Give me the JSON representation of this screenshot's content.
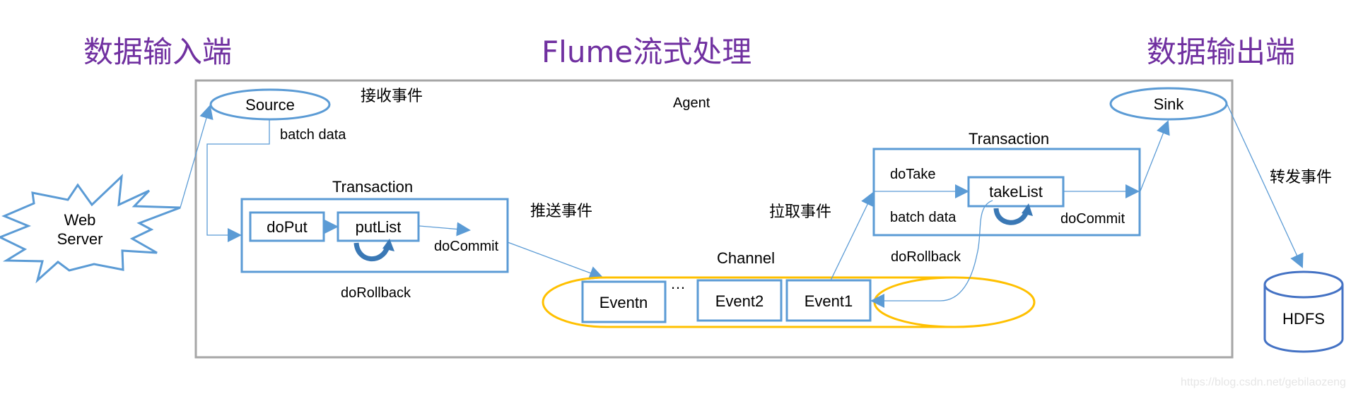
{
  "titles": {
    "input_end": "数据输入端",
    "main": "Flume流式处理",
    "output_end": "数据输出端"
  },
  "agent": {
    "label": "Agent"
  },
  "web_server": {
    "line1": "Web",
    "line2": "Server"
  },
  "source": {
    "label": "Source",
    "receive_label": "接收事件",
    "batch_label": "batch data"
  },
  "put_transaction": {
    "title": "Transaction",
    "do_put": "doPut",
    "put_list": "putList",
    "do_commit": "doCommit",
    "do_rollback": "doRollback",
    "push_label": "推送事件"
  },
  "channel": {
    "label": "Channel",
    "events": [
      "Eventn",
      "Event2",
      "Event1"
    ],
    "ellipsis": "…"
  },
  "take_transaction": {
    "title": "Transaction",
    "do_take": "doTake",
    "take_list": "takeList",
    "batch_label": "batch data",
    "do_commit": "doCommit",
    "do_rollback": "doRollback",
    "pull_label": "拉取事件"
  },
  "sink": {
    "label": "Sink",
    "forward_label": "转发事件"
  },
  "hdfs": {
    "label": "HDFS"
  },
  "watermark": "https://blog.csdn.net/gebilaozeng",
  "colors": {
    "title": "#7030A0",
    "shape_stroke": "#5B9BD5",
    "channel_stroke": "#FFC000",
    "agent_border": "#A6A6A6",
    "hdfs_stroke": "#4472C4"
  }
}
